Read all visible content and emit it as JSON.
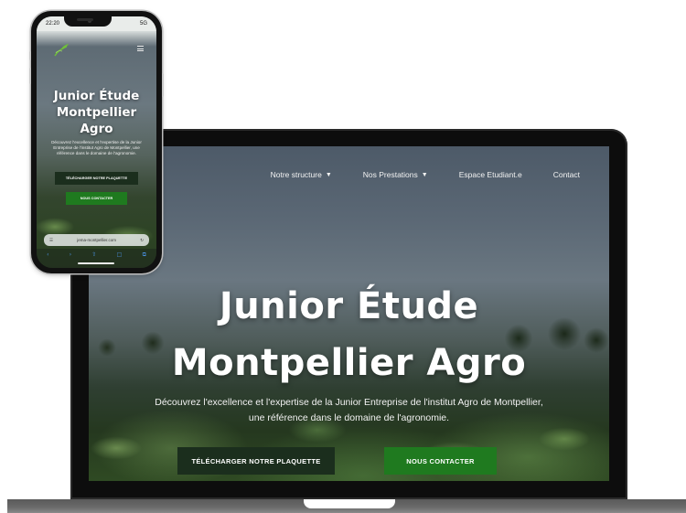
{
  "laptop": {
    "nav": [
      {
        "label": "Notre structure",
        "has_dropdown": true
      },
      {
        "label": "Nos Prestations",
        "has_dropdown": true
      },
      {
        "label": "Espace Etudiant.e",
        "has_dropdown": false
      },
      {
        "label": "Contact",
        "has_dropdown": false
      }
    ],
    "title_line1": "Junior Étude",
    "title_line2": "Montpellier Agro",
    "subtitle_line1": "Découvrez l'excellence et l'expertise de la Junior Entreprise de l'institut Agro de Montpellier,",
    "subtitle_line2": "une référence dans le domaine de l'agronomie.",
    "btn_download": "Télécharger notre plaquette",
    "btn_contact": "Nous contacter"
  },
  "phone": {
    "time": "22:20",
    "status_right": "5G",
    "title_line1": "Junior Étude",
    "title_line2": "Montpellier",
    "title_line3": "Agro",
    "subtitle": "Découvrez l'excellence et l'expertise de la Junior Entreprise de l'institut Agro de Montpellier, une référence dans le domaine de l'agronomie.",
    "btn_download": "Télécharger notre plaquette",
    "btn_contact": "Nous contacter",
    "url": "jema-montpellier.com"
  },
  "colors": {
    "accent_green": "#1f7a1f",
    "dark_green": "#1b2e1d"
  }
}
